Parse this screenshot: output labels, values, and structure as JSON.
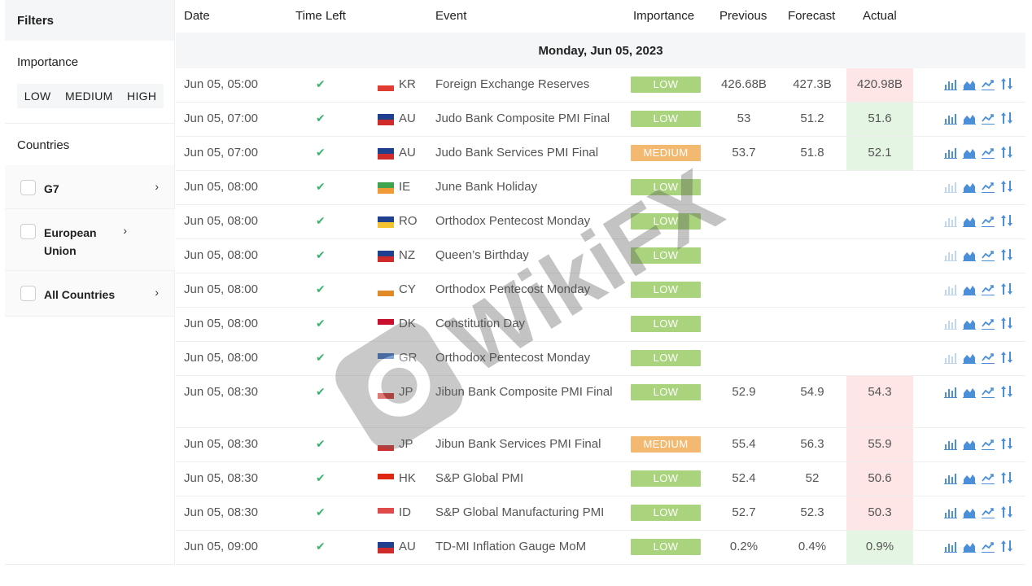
{
  "sidebar": {
    "title": "Filters",
    "importance_title": "Importance",
    "importance_options": [
      "LOW",
      "MEDIUM",
      "HIGH"
    ],
    "countries_title": "Countries",
    "countries": [
      {
        "label": "G7"
      },
      {
        "label": "European Union"
      },
      {
        "label": "All Countries"
      }
    ]
  },
  "table": {
    "headers": {
      "date": "Date",
      "time_left": "Time Left",
      "event": "Event",
      "importance": "Importance",
      "previous": "Previous",
      "forecast": "Forecast",
      "actual": "Actual"
    },
    "date_group": "Monday, Jun 05, 2023",
    "rows": [
      {
        "date": "Jun 05, 05:00",
        "code": "KR",
        "event": "Foreign Exchange Reserves",
        "importance": "LOW",
        "previous": "426.68B",
        "forecast": "427.3B",
        "actual": "420.98B",
        "actual_status": "red"
      },
      {
        "date": "Jun 05, 07:00",
        "code": "AU",
        "event": "Judo Bank Composite PMI Final",
        "importance": "LOW",
        "previous": "53",
        "forecast": "51.2",
        "actual": "51.6",
        "actual_status": "green"
      },
      {
        "date": "Jun 05, 07:00",
        "code": "AU",
        "event": "Judo Bank Services PMI Final",
        "importance": "MEDIUM",
        "previous": "53.7",
        "forecast": "51.8",
        "actual": "52.1",
        "actual_status": "green"
      },
      {
        "date": "Jun 05, 08:00",
        "code": "IE",
        "event": "June Bank Holiday",
        "importance": "LOW",
        "previous": "",
        "forecast": "",
        "actual": "",
        "actual_status": ""
      },
      {
        "date": "Jun 05, 08:00",
        "code": "RO",
        "event": "Orthodox Pentecost Monday",
        "importance": "LOW",
        "previous": "",
        "forecast": "",
        "actual": "",
        "actual_status": ""
      },
      {
        "date": "Jun 05, 08:00",
        "code": "NZ",
        "event": "Queen’s Birthday",
        "importance": "LOW",
        "previous": "",
        "forecast": "",
        "actual": "",
        "actual_status": ""
      },
      {
        "date": "Jun 05, 08:00",
        "code": "CY",
        "event": "Orthodox Pentecost Monday",
        "importance": "LOW",
        "previous": "",
        "forecast": "",
        "actual": "",
        "actual_status": ""
      },
      {
        "date": "Jun 05, 08:00",
        "code": "DK",
        "event": "Constitution Day",
        "importance": "LOW",
        "previous": "",
        "forecast": "",
        "actual": "",
        "actual_status": ""
      },
      {
        "date": "Jun 05, 08:00",
        "code": "GR",
        "event": "Orthodox Pentecost Monday",
        "importance": "LOW",
        "previous": "",
        "forecast": "",
        "actual": "",
        "actual_status": ""
      },
      {
        "date": "Jun 05, 08:30",
        "code": "JP",
        "event": "Jibun Bank Composite PMI Final",
        "importance": "LOW",
        "previous": "52.9",
        "forecast": "54.9",
        "actual": "54.3",
        "actual_status": "red"
      },
      {
        "date": "Jun 05, 08:30",
        "code": "JP",
        "event": "Jibun Bank Services PMI Final",
        "importance": "MEDIUM",
        "previous": "55.4",
        "forecast": "56.3",
        "actual": "55.9",
        "actual_status": "red"
      },
      {
        "date": "Jun 05, 08:30",
        "code": "HK",
        "event": "S&P Global PMI",
        "importance": "LOW",
        "previous": "52.4",
        "forecast": "52",
        "actual": "50.6",
        "actual_status": "red"
      },
      {
        "date": "Jun 05, 08:30",
        "code": "ID",
        "event": "S&P Global Manufacturing PMI",
        "importance": "LOW",
        "previous": "52.7",
        "forecast": "52.3",
        "actual": "50.3",
        "actual_status": "red"
      },
      {
        "date": "Jun 05, 09:00",
        "code": "AU",
        "event": "TD-MI Inflation Gauge MoM",
        "importance": "LOW",
        "previous": "0.2%",
        "forecast": "0.4%",
        "actual": "0.9%",
        "actual_status": "green"
      }
    ]
  },
  "watermark": {
    "text": "WikiFX"
  },
  "colors": {
    "low": "#a9d37c",
    "medium": "#f4b971",
    "actual_red": "#fde6e5",
    "actual_green": "#e4f6e3",
    "check": "#3cb371",
    "icon_blue": "#4a8fd8"
  }
}
